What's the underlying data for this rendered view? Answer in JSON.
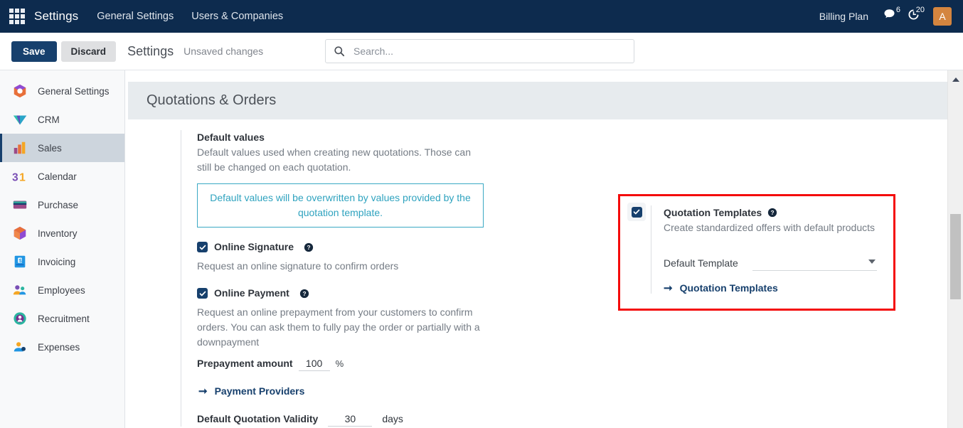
{
  "navbar": {
    "apps_icon": "apps-grid-icon",
    "brand": "Settings",
    "links": [
      {
        "label": "General Settings"
      },
      {
        "label": "Users & Companies"
      }
    ],
    "billing_label": "Billing Plan",
    "messages_icon": "chat-bubble-icon",
    "messages_count": "6",
    "activities_icon": "clock-icon",
    "activities_count": "20",
    "avatar_initial": "A"
  },
  "control_panel": {
    "save_label": "Save",
    "discard_label": "Discard",
    "title": "Settings",
    "status": "Unsaved changes",
    "search_icon": "search-icon",
    "search_value": "",
    "search_placeholder": "Search..."
  },
  "sidebar": {
    "items": [
      {
        "label": "General Settings",
        "icon": "general-settings-icon",
        "active": false
      },
      {
        "label": "CRM",
        "icon": "crm-icon",
        "active": false
      },
      {
        "label": "Sales",
        "icon": "sales-icon",
        "active": true
      },
      {
        "label": "Calendar",
        "icon": "calendar-icon",
        "active": false
      },
      {
        "label": "Purchase",
        "icon": "purchase-icon",
        "active": false
      },
      {
        "label": "Inventory",
        "icon": "inventory-icon",
        "active": false
      },
      {
        "label": "Invoicing",
        "icon": "invoicing-icon",
        "active": false
      },
      {
        "label": "Employees",
        "icon": "employees-icon",
        "active": false
      },
      {
        "label": "Recruitment",
        "icon": "recruitment-icon",
        "active": false
      },
      {
        "label": "Expenses",
        "icon": "expenses-icon",
        "active": false
      }
    ]
  },
  "main": {
    "section_title": "Quotations & Orders",
    "left_column": {
      "default_values": {
        "title": "Default values",
        "description": "Default values used when creating new quotations. Those can still be changed on each quotation.",
        "alert": "Default values will be overwritten by values provided by the quotation template.",
        "alert_color": "#2fa3bf"
      },
      "online_signature": {
        "label": "Online Signature",
        "checked": true,
        "help_icon": "help-circle-icon",
        "description": "Request an online signature to confirm orders"
      },
      "online_payment": {
        "label": "Online Payment",
        "checked": true,
        "help_icon": "help-circle-icon",
        "description": "Request an online prepayment from your customers to confirm orders. You can ask them to fully pay the order or partially with a downpayment",
        "prepayment_label": "Prepayment amount",
        "prepayment_value": "100",
        "prepayment_unit": "%",
        "link_label": "Payment Providers",
        "link_icon": "arrow-right-icon"
      },
      "quotation_validity": {
        "label": "Default Quotation Validity",
        "value": "30",
        "unit": "days"
      }
    },
    "right_column": {
      "quotation_templates": {
        "label": "Quotation Templates",
        "checked": true,
        "help_icon": "help-circle-icon",
        "description": "Create standardized offers with default products",
        "default_template_label": "Default Template",
        "default_template_value": "",
        "dropdown_icon": "chevron-down-icon",
        "link_label": "Quotation Templates",
        "link_icon": "arrow-right-icon",
        "highlight_color": "#f40b0b"
      }
    }
  },
  "scrollbar": {
    "up_arrow_icon": "caret-up-icon",
    "thumb": "scroll-thumb"
  }
}
